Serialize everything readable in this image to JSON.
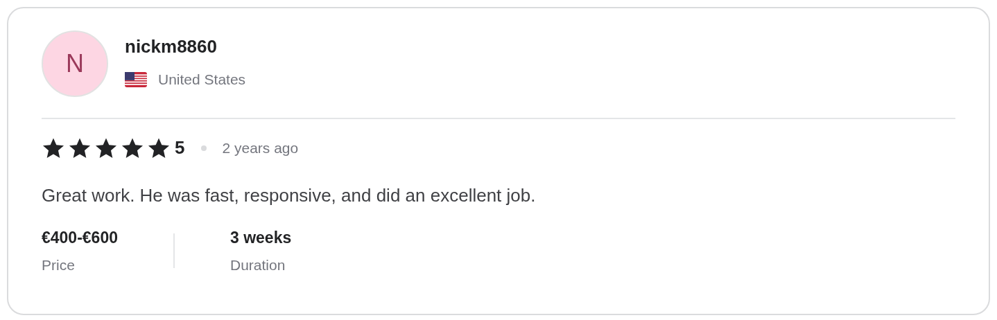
{
  "reviewer": {
    "avatar_initial": "N",
    "username": "nickm8860",
    "country": "United States"
  },
  "review": {
    "stars": 5,
    "rating": "5",
    "time": "2 years ago",
    "text": "Great work. He was fast, responsive, and did an excellent job."
  },
  "stats": [
    {
      "value": "€400-€600",
      "label": "Price"
    },
    {
      "value": "3 weeks",
      "label": "Duration"
    }
  ]
}
